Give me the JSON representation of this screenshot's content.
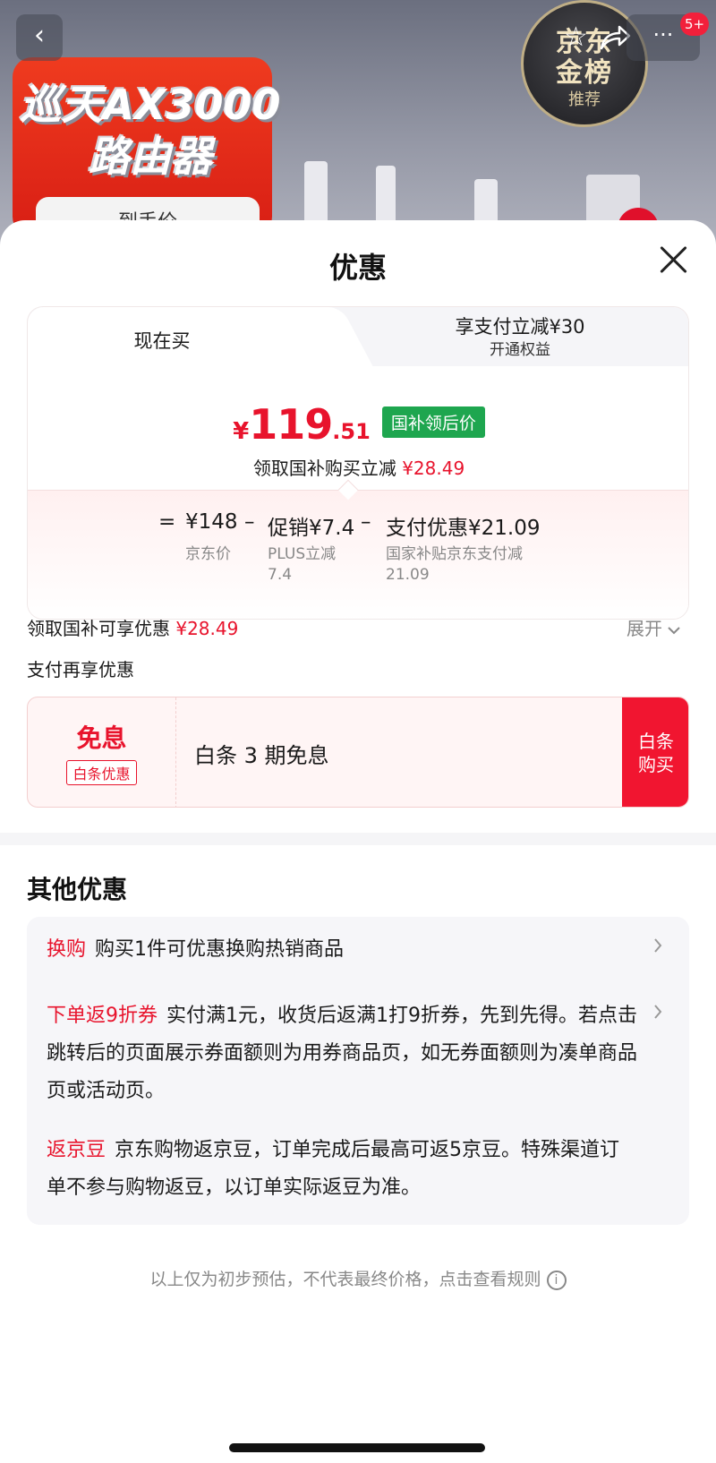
{
  "hero": {
    "promo_title_line1": "巡天AX3000",
    "promo_title_line2": "路由器",
    "promo_sub": "到手价",
    "back_glyph": "‹",
    "more_glyph": "···",
    "badge": "5+",
    "medal_top": "京东",
    "medal_mid": "金榜",
    "medal_bot": "推荐"
  },
  "sheet": {
    "title": "优惠"
  },
  "price_card": {
    "tab_now": "现在买",
    "tab_pay_main": "享支付立减¥30",
    "tab_pay_sub": "开通权益",
    "price_yen": "¥",
    "price_int": "119",
    "price_dec": ".51",
    "price_tag": "国补领后价",
    "claim_text": "领取国补购买立减",
    "claim_amount": "¥28.49",
    "calc": {
      "eq": "=",
      "jd_price": "¥148",
      "minus1": "–",
      "promo": "促销¥7.4",
      "minus2": "–",
      "pay_discount": "支付优惠¥21.09",
      "jd_price_label": "京东价",
      "promo_label_1": "PLUS立减",
      "promo_label_2": "7.4",
      "pay_label_1": "国家补贴京东支付减",
      "pay_label_2": "21.09"
    }
  },
  "savings": {
    "text": "领取国补可享优惠",
    "amount": "¥28.49",
    "expand": "展开"
  },
  "pay_again": "支付再享优惠",
  "baitiao": {
    "free_label": "免息",
    "tag": "白条优惠",
    "desc": "白条 3 期免息",
    "btn_line1": "白条",
    "btn_line2": "购买"
  },
  "other": {
    "title": "其他优惠",
    "items": [
      {
        "tag": "换购",
        "text": "购买1件可优惠换购热销商品"
      },
      {
        "tag": "下单返9折券",
        "text": "实付满1元，收货后返满1打9折券，先到先得。若点击跳转后的页面展示券面额则为用券商品页，如无券面额则为凑单商品页或活动页。"
      },
      {
        "tag": "返京豆",
        "text": "京东购物返京豆，订单完成后最高可返5京豆。特殊渠道订单不参与购物返豆，以订单实际返豆为准。"
      }
    ]
  },
  "disclaimer": "以上仅为初步预估，不代表最终价格，点击查看规则",
  "colors": {
    "accent_red": "#e8132c",
    "tag_green": "#1ea64f",
    "button_red": "#f11530"
  },
  "icons": [
    "back-arrow-icon",
    "more-icon",
    "star-icon",
    "share-icon",
    "close-icon",
    "chevron-down-icon",
    "chevron-right-icon",
    "info-icon"
  ]
}
